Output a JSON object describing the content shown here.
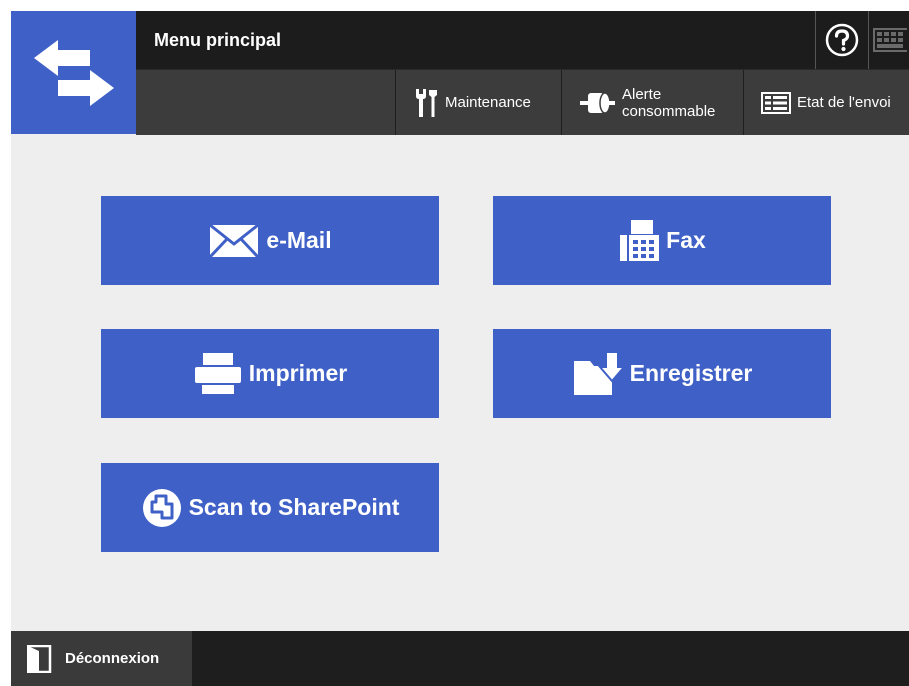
{
  "header": {
    "title": "Menu principal",
    "help_icon": "help-icon",
    "keyboard_icon": "keyboard-icon"
  },
  "toolbar": {
    "maintenance_label": "Maintenance",
    "consumable_line1": "Alerte",
    "consumable_line2": "consommable",
    "send_status_label": "Etat de l'envoi"
  },
  "menu": {
    "email_label": "e-Mail",
    "fax_label": "Fax",
    "print_label": "Imprimer",
    "save_label": "Enregistrer",
    "sharepoint_label": "Scan to SharePoint"
  },
  "footer": {
    "logout_label": "Déconnexion"
  },
  "colors": {
    "accent": "#3f61c7",
    "header_bg": "#1c1c1c",
    "toolbar_bg": "#3c3c3c",
    "content_bg": "#eeeeee"
  }
}
